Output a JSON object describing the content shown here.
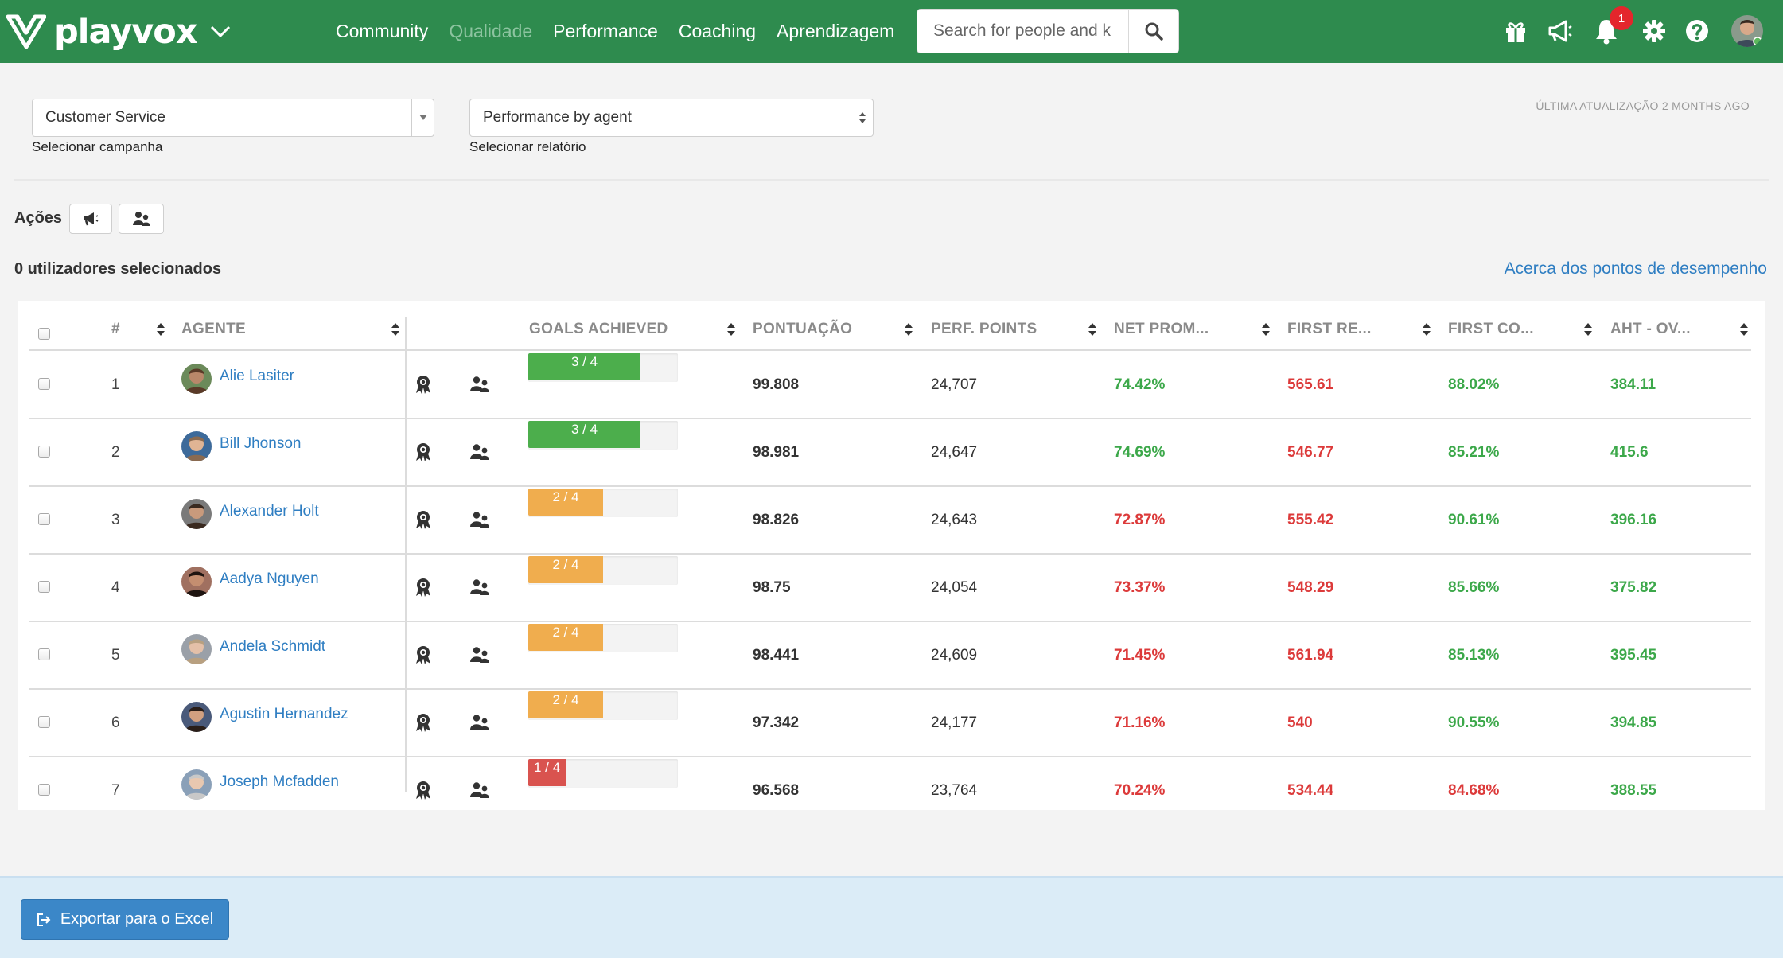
{
  "app": {
    "brand": "playvox"
  },
  "nav": [
    "Community",
    "Qualidade",
    "Performance",
    "Coaching",
    "Aprendizagem"
  ],
  "search": {
    "placeholder": "Search for people and k"
  },
  "notifications": {
    "count": "1"
  },
  "filters": {
    "campaign": {
      "value": "Customer Service",
      "caption": "Selecionar campanha"
    },
    "report": {
      "value": "Performance by agent",
      "caption": "Selecionar relatório"
    },
    "last_update": "ÚLTIMA ATUALIZAÇÃO 2 MONTHS AGO"
  },
  "actions": {
    "label": "Ações"
  },
  "selection": {
    "count_text": "0 utilizadores selecionados",
    "about_link": "Acerca dos pontos de desempenho"
  },
  "table": {
    "headers": [
      "#",
      "AGENTE",
      "GOALS ACHIEVED",
      "PONTUAÇÃO",
      "PERF. POINTS",
      "NET PROM...",
      "FIRST RE...",
      "FIRST CO...",
      "AHT - OV..."
    ],
    "rows": [
      {
        "rank": "1",
        "agent": "Alie Lasiter",
        "goals": "3 / 4",
        "goal_fraction": 0.75,
        "goal_color": "#4cae4c",
        "score": "99.808",
        "perf_points": "24,707",
        "net_prom": "74.42%",
        "first_re": "565.61",
        "first_co": "88.02%",
        "aht": "384.11",
        "net_prom_status": "good",
        "first_re_status": "bad",
        "first_co_status": "good",
        "aht_status": "good"
      },
      {
        "rank": "2",
        "agent": "Bill Jhonson",
        "goals": "3 / 4",
        "goal_fraction": 0.75,
        "goal_color": "#4cae4c",
        "score": "98.981",
        "perf_points": "24,647",
        "net_prom": "74.69%",
        "first_re": "546.77",
        "first_co": "85.21%",
        "aht": "415.6",
        "net_prom_status": "good",
        "first_re_status": "bad",
        "first_co_status": "good",
        "aht_status": "good"
      },
      {
        "rank": "3",
        "agent": "Alexander Holt",
        "goals": "2 / 4",
        "goal_fraction": 0.5,
        "goal_color": "#f0ad4e",
        "score": "98.826",
        "perf_points": "24,643",
        "net_prom": "72.87%",
        "first_re": "555.42",
        "first_co": "90.61%",
        "aht": "396.16",
        "net_prom_status": "bad",
        "first_re_status": "bad",
        "first_co_status": "good",
        "aht_status": "good"
      },
      {
        "rank": "4",
        "agent": "Aadya Nguyen",
        "goals": "2 / 4",
        "goal_fraction": 0.5,
        "goal_color": "#f0ad4e",
        "score": "98.75",
        "perf_points": "24,054",
        "net_prom": "73.37%",
        "first_re": "548.29",
        "first_co": "85.66%",
        "aht": "375.82",
        "net_prom_status": "bad",
        "first_re_status": "bad",
        "first_co_status": "good",
        "aht_status": "good"
      },
      {
        "rank": "5",
        "agent": "Andela Schmidt",
        "goals": "2 / 4",
        "goal_fraction": 0.5,
        "goal_color": "#f0ad4e",
        "score": "98.441",
        "perf_points": "24,609",
        "net_prom": "71.45%",
        "first_re": "561.94",
        "first_co": "85.13%",
        "aht": "395.45",
        "net_prom_status": "bad",
        "first_re_status": "bad",
        "first_co_status": "good",
        "aht_status": "good"
      },
      {
        "rank": "6",
        "agent": "Agustin Hernandez",
        "goals": "2 / 4",
        "goal_fraction": 0.5,
        "goal_color": "#f0ad4e",
        "score": "97.342",
        "perf_points": "24,177",
        "net_prom": "71.16%",
        "first_re": "540",
        "first_co": "90.55%",
        "aht": "394.85",
        "net_prom_status": "bad",
        "first_re_status": "bad",
        "first_co_status": "good",
        "aht_status": "good"
      },
      {
        "rank": "7",
        "agent": "Joseph Mcfadden",
        "goals": "1 / 4",
        "goal_fraction": 0.25,
        "goal_color": "#d9534f",
        "score": "96.568",
        "perf_points": "23,764",
        "net_prom": "70.24%",
        "first_re": "534.44",
        "first_co": "84.68%",
        "aht": "388.55",
        "net_prom_status": "bad",
        "first_re_status": "bad",
        "first_co_status": "bad",
        "aht_status": "good"
      }
    ]
  },
  "footer": {
    "export_label": "Exportar para o Excel"
  },
  "colors": {
    "brand": "#2e8b4e",
    "good": "#3ca84a",
    "bad": "#dc3a3a",
    "link": "#2f7ec2",
    "export": "#3b87c8"
  }
}
